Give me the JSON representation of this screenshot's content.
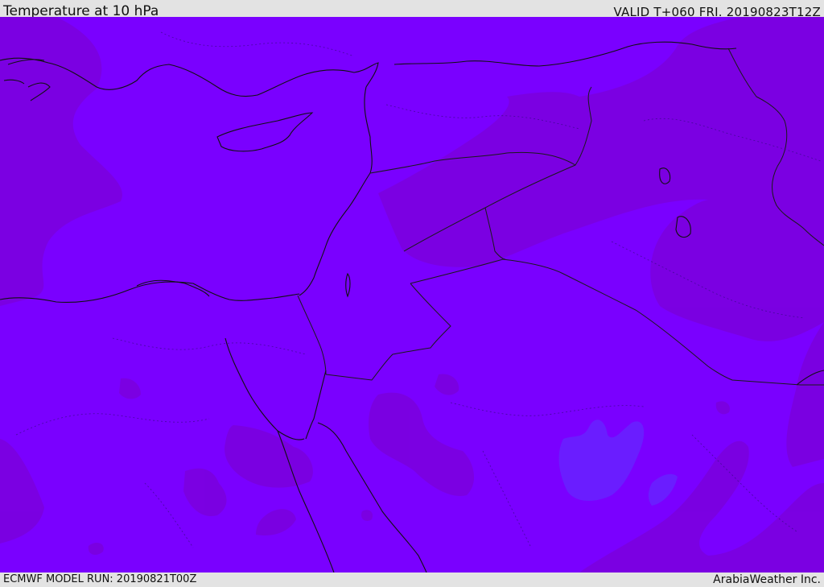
{
  "header": {
    "title": "Temperature at 10 hPa",
    "valid_time": "VALID T+060 FRI. 20190823T12Z"
  },
  "map": {
    "variable": "Temperature",
    "level": "10 hPa",
    "region": "Eastern Mediterranean / Middle East",
    "colors": {
      "base_fill": "#7a00ff",
      "warm_band": "#7b00e0",
      "cold_pocket": "#6a1dff",
      "coastline": "#111111",
      "border": "#1a1a1a"
    }
  },
  "footer": {
    "model_run": "ECMWF MODEL RUN: 20190821T00Z",
    "credit": "ArabiaWeather Inc."
  }
}
